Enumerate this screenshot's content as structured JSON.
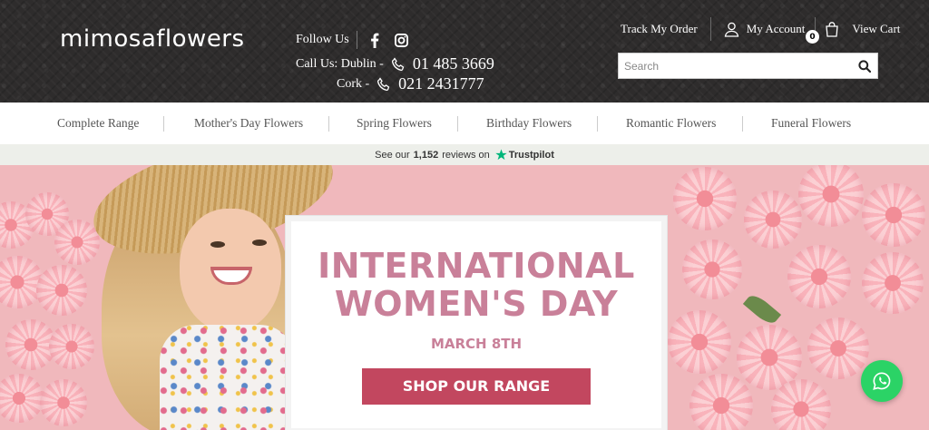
{
  "header": {
    "logo": "mimosaflowers",
    "follow_label": "Follow Us",
    "call_dublin_label": "Call Us: Dublin -",
    "call_dublin_number": "01 485 3669",
    "call_cork_label": "Cork -",
    "call_cork_number": "021 2431777",
    "track_order": "Track My Order",
    "my_account": "My Account",
    "view_cart": "View Cart",
    "cart_count": "0",
    "search_placeholder": "Search"
  },
  "nav": {
    "items": [
      "Complete Range",
      "Mother's Day Flowers",
      "Spring Flowers",
      "Birthday Flowers",
      "Romantic Flowers",
      "Funeral Flowers"
    ]
  },
  "trust": {
    "prefix": "See our",
    "count": "1,152",
    "suffix": "reviews on",
    "brand": "Trustpilot"
  },
  "hero": {
    "title_line1": "INTERNATIONAL",
    "title_line2": "WOMEN'S DAY",
    "date": "MARCH 8TH",
    "cta": "SHOP OUR RANGE"
  },
  "colors": {
    "header_bg": "#2e2c2c",
    "hero_bg": "#f0b8bc",
    "accent_pink": "#c98099",
    "cta": "#c2475f",
    "whatsapp": "#2bd366"
  },
  "icons": [
    "facebook-icon",
    "instagram-icon",
    "phone-icon",
    "user-icon",
    "cart-icon",
    "search-icon",
    "trustpilot-star-icon",
    "whatsapp-icon"
  ]
}
